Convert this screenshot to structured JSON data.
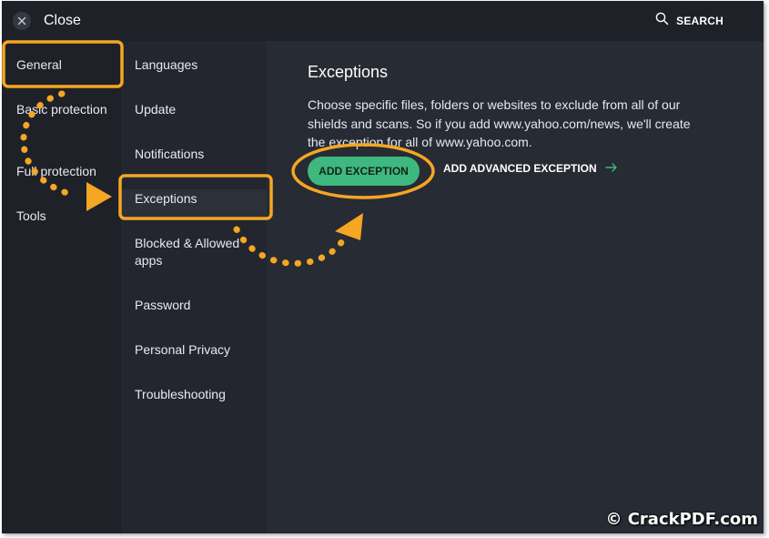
{
  "topbar": {
    "close_label": "Close",
    "search_label": "SEARCH"
  },
  "nav": {
    "items": [
      {
        "label": "General"
      },
      {
        "label": "Basic protection"
      },
      {
        "label": "Full protection"
      },
      {
        "label": "Tools"
      }
    ]
  },
  "subnav": {
    "items": [
      {
        "label": "Languages"
      },
      {
        "label": "Update"
      },
      {
        "label": "Notifications"
      },
      {
        "label": "Exceptions"
      },
      {
        "label": "Blocked & Allowed apps"
      },
      {
        "label": "Password"
      },
      {
        "label": "Personal Privacy"
      },
      {
        "label": "Troubleshooting"
      }
    ]
  },
  "main": {
    "title": "Exceptions",
    "description": "Choose specific files, folders or websites to exclude from all of our shields and scans. So if you add www.yahoo.com/news, we'll create the exception for all of www.yahoo.com.",
    "add_exception_label": "ADD EXCEPTION",
    "add_advanced_label": "ADD ADVANCED EXCEPTION"
  },
  "watermark": "© CrackPDF.com",
  "colors": {
    "accent_green": "#3fb87f",
    "annotation_orange": "#f5a623",
    "background": "#272b33"
  },
  "icons": [
    "close-icon",
    "search-icon",
    "arrow-right-icon"
  ]
}
